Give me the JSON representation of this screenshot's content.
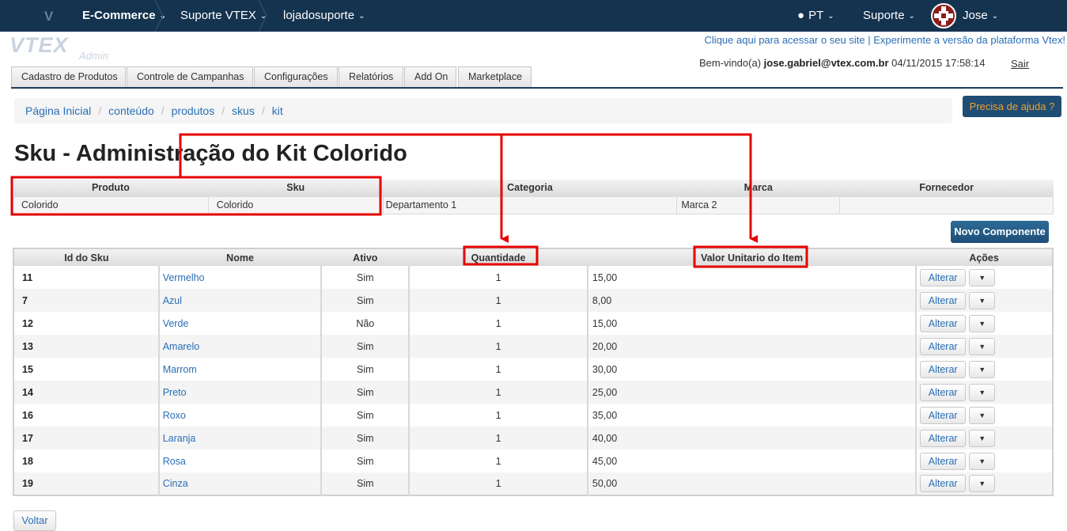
{
  "topbar": {
    "logo": "V",
    "nav": [
      "E-Commerce",
      "Suporte VTEX",
      "lojadosuporte"
    ],
    "language": "PT",
    "support": "Suporte",
    "user": "Jose"
  },
  "header": {
    "vtex_logo": "VTEX",
    "vtex_admin": "Admin",
    "link_site": "Clique aqui para acessar o seu site",
    "link_separator": " | ",
    "link_new": "Experimente a versão da plataforma Vtex!",
    "welcome_prefix": "Bem-vindo(a) ",
    "welcome_email": "jose.gabriel@vtex.com.br",
    "welcome_datetime": " 04/11/2015 17:58:14",
    "logout": "Sair"
  },
  "tabs": [
    "Cadastro de Produtos",
    "Controle de Campanhas",
    "Configurações",
    "Relatórios",
    "Add On",
    "Marketplace"
  ],
  "breadcrumb": [
    "Página Inicial",
    "conteúdo",
    "produtos",
    "skus",
    "kit"
  ],
  "help_button": "Precisa de ajuda ?",
  "title": "Sku - Administração do Kit Colorido",
  "info": {
    "headers": [
      "Produto",
      "Sku",
      "Categoria",
      "Marca",
      "Fornecedor"
    ],
    "values": [
      "Colorido",
      "Colorido",
      "Departamento 1",
      "Marca 2",
      ""
    ]
  },
  "new_component_button": "Novo Componente",
  "components": {
    "headers": [
      "Id do Sku",
      "Nome",
      "Ativo",
      "Quantidade",
      "Valor Unitario do Item",
      "Ações"
    ],
    "edit_label": "Alterar",
    "caret": "▼",
    "rows": [
      {
        "id": "11",
        "name": "Vermelho",
        "active": "Sim",
        "qty": "1",
        "value": "15,00"
      },
      {
        "id": "7",
        "name": "Azul",
        "active": "Sim",
        "qty": "1",
        "value": "8,00"
      },
      {
        "id": "12",
        "name": "Verde",
        "active": "Não",
        "qty": "1",
        "value": "15,00"
      },
      {
        "id": "13",
        "name": "Amarelo",
        "active": "Sim",
        "qty": "1",
        "value": "20,00"
      },
      {
        "id": "15",
        "name": "Marrom",
        "active": "Sim",
        "qty": "1",
        "value": "30,00"
      },
      {
        "id": "14",
        "name": "Preto",
        "active": "Sim",
        "qty": "1",
        "value": "25,00"
      },
      {
        "id": "16",
        "name": "Roxo",
        "active": "Sim",
        "qty": "1",
        "value": "35,00"
      },
      {
        "id": "17",
        "name": "Laranja",
        "active": "Sim",
        "qty": "1",
        "value": "40,00"
      },
      {
        "id": "18",
        "name": "Rosa",
        "active": "Sim",
        "qty": "1",
        "value": "45,00"
      },
      {
        "id": "19",
        "name": "Cinza",
        "active": "Sim",
        "qty": "1",
        "value": "50,00"
      }
    ]
  },
  "back_button": "Voltar",
  "colors": {
    "navbar": "#14334f",
    "link": "#2a6fb5",
    "annotation": "#e60000",
    "help_text": "#f0a030"
  }
}
